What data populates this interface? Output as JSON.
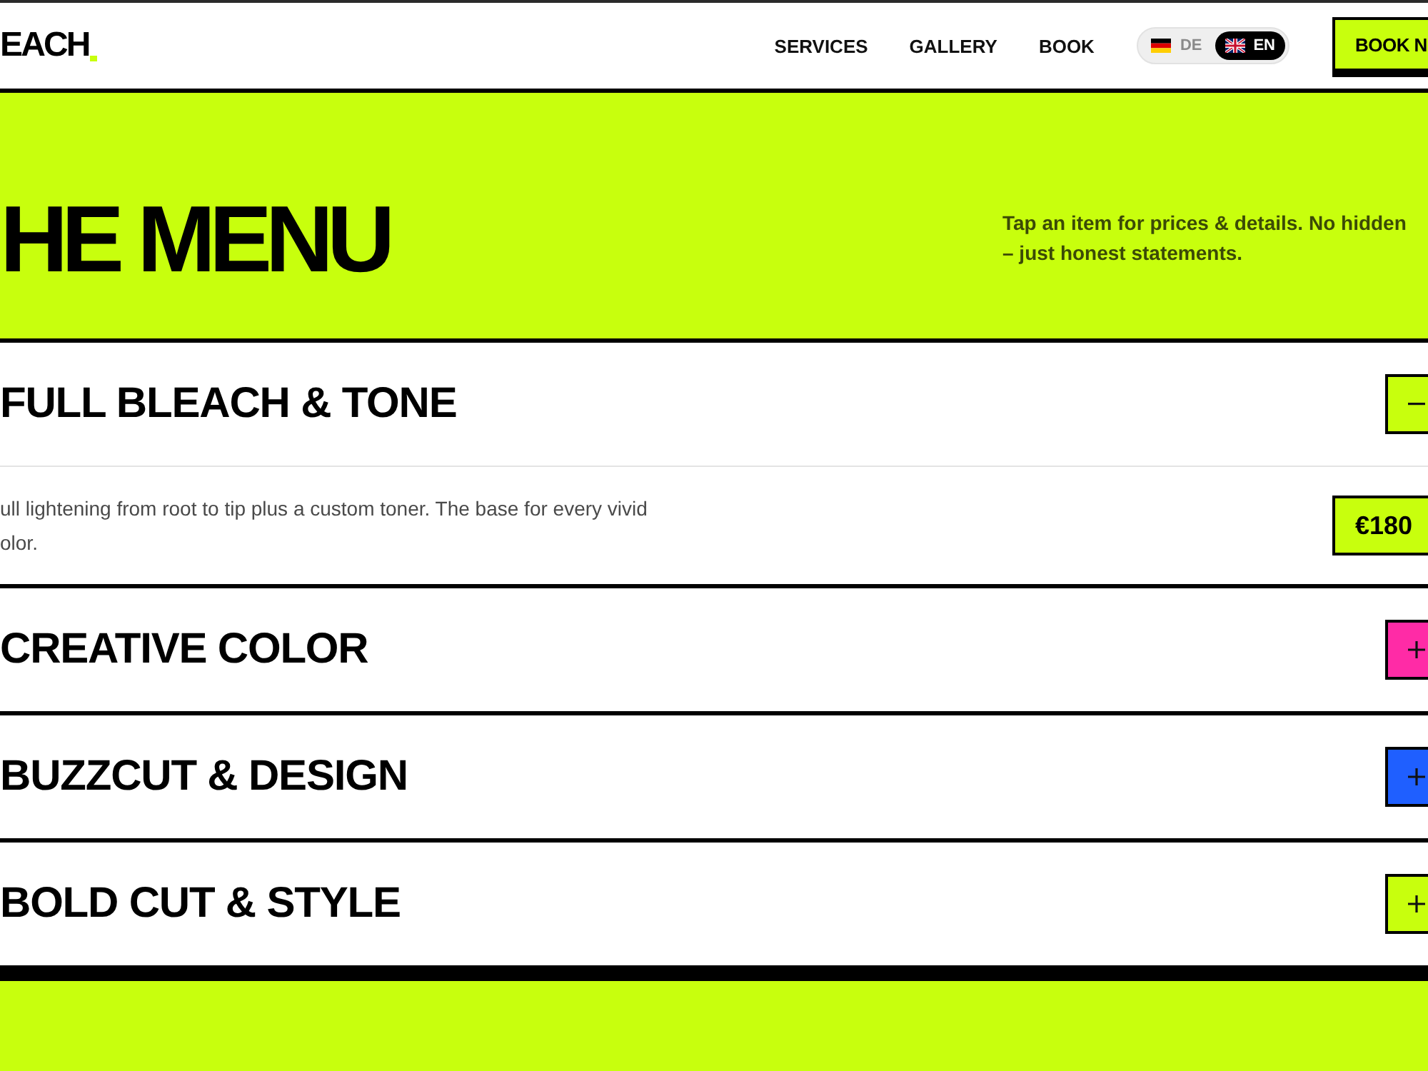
{
  "header": {
    "logo": "EACH",
    "nav": [
      "SERVICES",
      "GALLERY",
      "BOOK"
    ],
    "languages": [
      {
        "kind": "de",
        "label": "DE",
        "selected": false
      },
      {
        "kind": "gb",
        "label": "EN",
        "selected": true
      }
    ],
    "cta": "BOOK N"
  },
  "hero": {
    "title": "HE MENU",
    "intro": "Tap an item for prices & details. No hidden\n– just honest statements."
  },
  "items": [
    {
      "title": "FULL BLEACH & TONE",
      "expanded": true,
      "color": "#c8ff0d",
      "description": "ull lightening from root to tip plus a custom toner. The base for every vivid\nolor.",
      "price": "€180"
    },
    {
      "title": "CREATIVE COLOR",
      "expanded": false,
      "color": "#ff2ba6"
    },
    {
      "title": "BUZZCUT & DESIGN",
      "expanded": false,
      "color": "#1f5fff"
    },
    {
      "title": "BOLD CUT & STYLE",
      "expanded": false,
      "color": "#c8ff0d"
    }
  ]
}
